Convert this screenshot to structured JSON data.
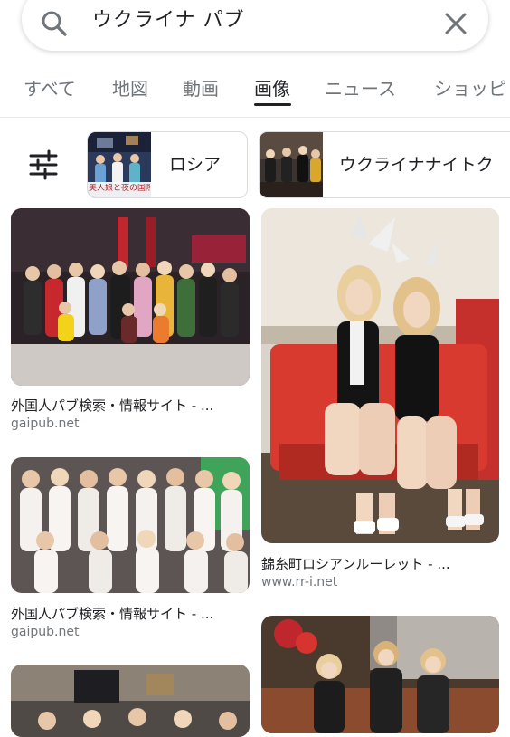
{
  "search": {
    "query": "ウクライナ パブ",
    "icons": {
      "search": "search-icon",
      "clear": "close-icon"
    }
  },
  "tabs": [
    {
      "label": "すべて"
    },
    {
      "label": "地図"
    },
    {
      "label": "動画"
    },
    {
      "label": "画像",
      "active": true
    },
    {
      "label": "ニュース"
    },
    {
      "label": "ショッピ"
    }
  ],
  "chips": {
    "filter_icon": "tune-sliders-icon",
    "items": [
      {
        "label": "ロシア",
        "thumb_caption": "美人娘と夜の国際"
      },
      {
        "label": "ウクライナナイトク"
      }
    ]
  },
  "results": [
    {
      "title": "外国人パブ検索・情報サイト - ...",
      "source": "gaipub.net"
    },
    {
      "title": "外国人パブ検索・情報サイト - ...",
      "source": "gaipub.net"
    },
    {
      "title": "錦糸町ロシアンルーレット - ...",
      "source": "www.rr-i.net"
    }
  ],
  "colors": {
    "text": "#202124",
    "muted": "#70757a",
    "border": "#dadce0",
    "sofa_red": "#d83a2f"
  }
}
